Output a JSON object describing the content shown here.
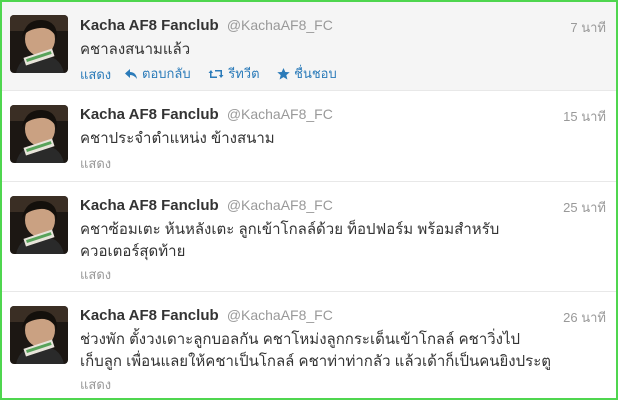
{
  "colors": {
    "frame_border": "#4fd64f",
    "link": "#2b7bb9",
    "muted": "#999999",
    "text": "#333333",
    "hover_bg": "#f5f5f5"
  },
  "tweets": [
    {
      "name": "Kacha AF8 Fanclub",
      "handle": "@KachaAF8_FC",
      "time": "7 นาที",
      "lines": [
        "คชาลงสนามแล้ว"
      ],
      "expand": "แสดง",
      "actions": {
        "reply": "ตอบกลับ",
        "retweet": "รีทวีต",
        "favorite": "ชื่นชอบ"
      }
    },
    {
      "name": "Kacha AF8 Fanclub",
      "handle": "@KachaAF8_FC",
      "time": "15 นาที",
      "lines": [
        "คชาประจำตำแหน่ง ข้างสนาม"
      ],
      "expand": "แสดง"
    },
    {
      "name": "Kacha AF8 Fanclub",
      "handle": "@KachaAF8_FC",
      "time": "25 นาที",
      "lines": [
        "คชาซ้อมเตะ ห้นหลังเตะ ลูกเข้าโกลล์ด้วย ท็อปฟอร์ม พร้อมสำหรับ",
        "ควอเตอร์สุดท้าย"
      ],
      "expand": "แสดง"
    },
    {
      "name": "Kacha AF8 Fanclub",
      "handle": "@KachaAF8_FC",
      "time": "26 นาที",
      "lines": [
        "ช่วงพัก ตั้งวงเดาะลูกบอลกัน คชาโหม่งลูกกระเด็นเข้าโกลล์ คชาวิ่งไป",
        "เก็บลูก เพื่อนแลยให้คชาเป็นโกลล์ คชาท่าท่ากลัว แล้วเด้าก็เป็นคนยิงประตู"
      ],
      "expand": "แสดง"
    }
  ]
}
